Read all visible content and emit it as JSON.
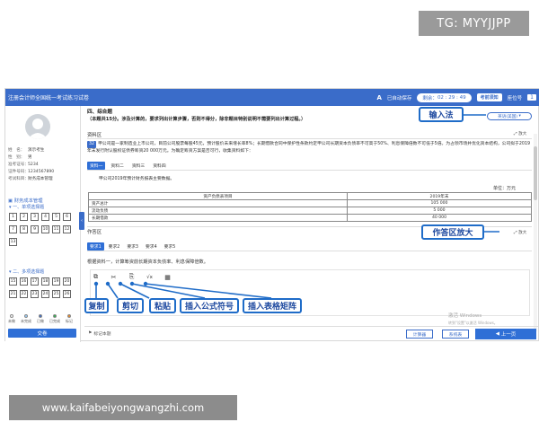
{
  "watermark": {
    "top": "TG: MYYJJPP",
    "bottom": "www.kaifabeiyongwangzhi.com"
  },
  "titlebar": {
    "title": "注册会计师全国统一考试练习试卷",
    "font_icon": "A",
    "auto_save": "已自动保存",
    "remaining_label": "剩余：",
    "remaining_time": "02 : 29 : 49",
    "cheat_sheet": "考前须知",
    "seat_label": "座位号",
    "seat_number": "1"
  },
  "candidate": {
    "name_label": "姓　名：",
    "name": "演示考生",
    "gender_label": "性　别：",
    "gender": "男",
    "exam_no_label": "准考证号：",
    "exam_no": "5234",
    "id_label": "证件号码：",
    "id": "1234567890",
    "subject_label": "考试科目：",
    "subject": "财务成本管理"
  },
  "nav": {
    "title": "财务成本管理",
    "section1": "一、单项选择题",
    "section1_items": [
      "1",
      "2",
      "3",
      "4",
      "5",
      "6",
      "7",
      "8",
      "9",
      "10",
      "11",
      "12",
      "13"
    ],
    "section2": "二、多项选择题",
    "section2_items": [
      "15",
      "16",
      "17",
      "18",
      "19",
      "20",
      "21",
      "22",
      "23",
      "24",
      "25",
      "26"
    ],
    "legend": [
      {
        "label": "未做",
        "color": "#ffffff"
      },
      {
        "label": "未完成",
        "color": "#9bd2ff"
      },
      {
        "label": "已做",
        "color": "#3a6cc9"
      },
      {
        "label": "已完成",
        "color": "#2ab34a"
      },
      {
        "label": "标记",
        "color": "#f08a24"
      }
    ],
    "submit": "交卷"
  },
  "question": {
    "section": "四、综合题",
    "desc": "（本题共15分。涉及计算的，要求列出计算步骤，否则不得分，除非题目特别说明不需要列出计算过程。）",
    "input_method": "英语(美国)",
    "material_label": "资料区",
    "zoom": "放大",
    "number": "32",
    "material_text": "甲公司是一家制造业上市公司，目前公司股票每股45元，预计股价未来增长率8%；长期借款合同中保护性条款约定甲公司长期资本负债率不可高于50%、利息保障倍数不可低于5倍。为占领市场并优化资本结构，公司拟于2019年末发行附认股权证债券筹资20 000万元。为确定筹资方案是否可行，收集资料如下：",
    "material_tabs": [
      "资料一",
      "资料二",
      "资料三",
      "资料四"
    ],
    "table_title": "甲公司2019年预计财务报表主要数据。",
    "unit": "单位：万元",
    "table_header": [
      "资产负债表项目",
      "2019年末"
    ],
    "table_rows": [
      [
        "资产总计",
        "105 000"
      ],
      [
        "流动负债",
        "5 000"
      ],
      [
        "长期借款",
        "40 000"
      ]
    ],
    "answer_label": "作答区",
    "answer_tabs": [
      "要求1",
      "要求2",
      "要求3",
      "要求4",
      "要求5"
    ],
    "ask": "根据资料一，计算筹资前长期资本负债率、利息保障倍数。",
    "toolbar": [
      "⧉",
      "✂",
      "⎘",
      "√x",
      "▦"
    ]
  },
  "bottom": {
    "flag": "标记本题",
    "activate_1": "激活 Windows",
    "activate_2": "转到\"设置\"以激活 Windows。",
    "calculator": "计算器",
    "system_msg": "系统表",
    "prev": "上一页"
  },
  "callouts": {
    "input_method": "输入法",
    "answer_zoom": "作答区放大",
    "copy": "复制",
    "cut": "剪切",
    "paste": "粘贴",
    "formula": "插入公式符号",
    "matrix": "插入表格矩阵"
  }
}
